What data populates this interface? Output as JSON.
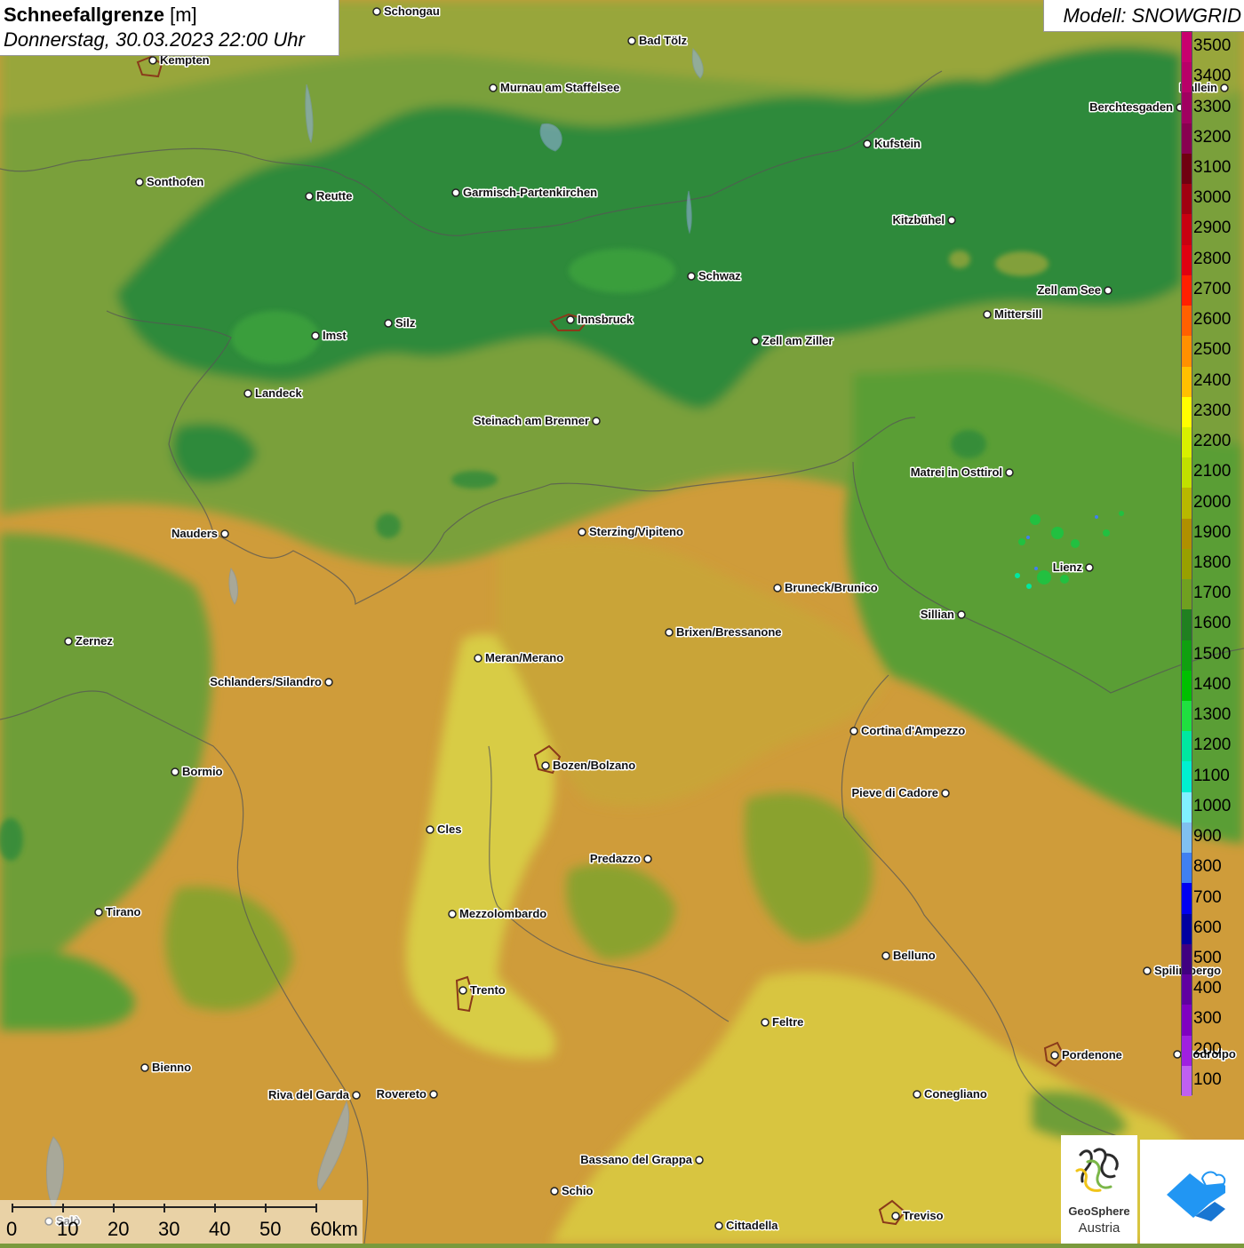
{
  "title": {
    "main": "Schneefallgrenze",
    "unit": "[m]",
    "datetime": "Donnerstag, 30.03.2023 22:00 Uhr"
  },
  "model": {
    "label": "Modell: SNOWGRID"
  },
  "legend": {
    "labels": [
      "3500",
      "3400",
      "3300",
      "3200",
      "3100",
      "3000",
      "2900",
      "2800",
      "2700",
      "2600",
      "2500",
      "2400",
      "2300",
      "2200",
      "2100",
      "2000",
      "1900",
      "1800",
      "1700",
      "1600",
      "1500",
      "1400",
      "1300",
      "1200",
      "1100",
      "1000",
      "900",
      "800",
      "700",
      "600",
      "500",
      "400",
      "300",
      "200",
      "100"
    ],
    "colors": [
      "#c8006e",
      "#b80068",
      "#a00060",
      "#880050",
      "#700010",
      "#a00010",
      "#c80010",
      "#e00010",
      "#ff2000",
      "#ff6000",
      "#ff9000",
      "#ffc000",
      "#ffff00",
      "#d8f000",
      "#c0e000",
      "#b8b800",
      "#b09000",
      "#98a000",
      "#70a020",
      "#208020",
      "#10a010",
      "#00c000",
      "#20e040",
      "#00e8a0",
      "#00f0d0",
      "#80f0ff",
      "#80c0f0",
      "#4080f0",
      "#0000f0",
      "#0000a0",
      "#400080",
      "#6000a0",
      "#8000c0",
      "#a020e0",
      "#c060f0"
    ]
  },
  "cities": [
    {
      "name": "Schongau",
      "anchor": "right"
    },
    {
      "name": "Bad Tölz",
      "anchor": "right"
    },
    {
      "name": "Kempten",
      "anchor": "right"
    },
    {
      "name": "Murnau am Staffelsee",
      "anchor": "right"
    },
    {
      "name": "Hallein",
      "anchor": "left"
    },
    {
      "name": "Berchtesgaden",
      "anchor": "left"
    },
    {
      "name": "Kufstein",
      "anchor": "right"
    },
    {
      "name": "Sonthofen",
      "anchor": "right"
    },
    {
      "name": "Reutte",
      "anchor": "right"
    },
    {
      "name": "Garmisch-Partenkirchen",
      "anchor": "right"
    },
    {
      "name": "Kitzbühel",
      "anchor": "left"
    },
    {
      "name": "Schwaz",
      "anchor": "right"
    },
    {
      "name": "Zell am See",
      "anchor": "left"
    },
    {
      "name": "Innsbruck",
      "anchor": "right"
    },
    {
      "name": "Mittersill",
      "anchor": "right"
    },
    {
      "name": "Imst",
      "anchor": "right"
    },
    {
      "name": "Silz",
      "anchor": "right"
    },
    {
      "name": "Zell am Ziller",
      "anchor": "right"
    },
    {
      "name": "Landeck",
      "anchor": "right"
    },
    {
      "name": "Steinach am Brenner",
      "anchor": "left"
    },
    {
      "name": "Matrei in Osttirol",
      "anchor": "left"
    },
    {
      "name": "Nauders",
      "anchor": "left"
    },
    {
      "name": "Sterzing/Vipiteno",
      "anchor": "right"
    },
    {
      "name": "Lienz",
      "anchor": "left"
    },
    {
      "name": "Bruneck/Brunico",
      "anchor": "right"
    },
    {
      "name": "Sillian",
      "anchor": "left"
    },
    {
      "name": "Brixen/Bressanone",
      "anchor": "right"
    },
    {
      "name": "Zernez",
      "anchor": "right"
    },
    {
      "name": "Meran/Merano",
      "anchor": "right"
    },
    {
      "name": "Schlanders/Silandro",
      "anchor": "left"
    },
    {
      "name": "Cortina d'Ampezzo",
      "anchor": "right"
    },
    {
      "name": "Bozen/Bolzano",
      "anchor": "right"
    },
    {
      "name": "Bormio",
      "anchor": "right"
    },
    {
      "name": "Pieve di Cadore",
      "anchor": "left"
    },
    {
      "name": "Cles",
      "anchor": "right"
    },
    {
      "name": "Predazzo",
      "anchor": "left"
    },
    {
      "name": "Tirano",
      "anchor": "right"
    },
    {
      "name": "Mezzolombardo",
      "anchor": "right"
    },
    {
      "name": "Belluno",
      "anchor": "right"
    },
    {
      "name": "Spilimbergo",
      "anchor": "right"
    },
    {
      "name": "Trento",
      "anchor": "right"
    },
    {
      "name": "Feltre",
      "anchor": "right"
    },
    {
      "name": "Pordenone",
      "anchor": "right"
    },
    {
      "name": "Codroipo",
      "anchor": "right"
    },
    {
      "name": "Bienno",
      "anchor": "right"
    },
    {
      "name": "Riva del Garda",
      "anchor": "left"
    },
    {
      "name": "Rovereto",
      "anchor": "left"
    },
    {
      "name": "Conegliano",
      "anchor": "right"
    },
    {
      "name": "Bassano del Grappa",
      "anchor": "left"
    },
    {
      "name": "Schio",
      "anchor": "right"
    },
    {
      "name": "Treviso",
      "anchor": "right"
    },
    {
      "name": "Cittadella",
      "anchor": "right"
    },
    {
      "name": "Salò",
      "anchor": "right"
    }
  ],
  "scalebar": {
    "labels": [
      "0",
      "10",
      "20",
      "30",
      "40",
      "50",
      "60km"
    ]
  },
  "logos": {
    "geosphere_line1": "GeoSphere",
    "geosphere_line2": "Austria"
  },
  "colors": {
    "dark_green": "#2e8a3a",
    "mid_green": "#5a9e35",
    "olive": "#8aa22e",
    "ochre": "#c9a437",
    "orange_ochre": "#cf9c3a",
    "yellow": "#d8cc45",
    "brand_blue": "#2196f3"
  }
}
